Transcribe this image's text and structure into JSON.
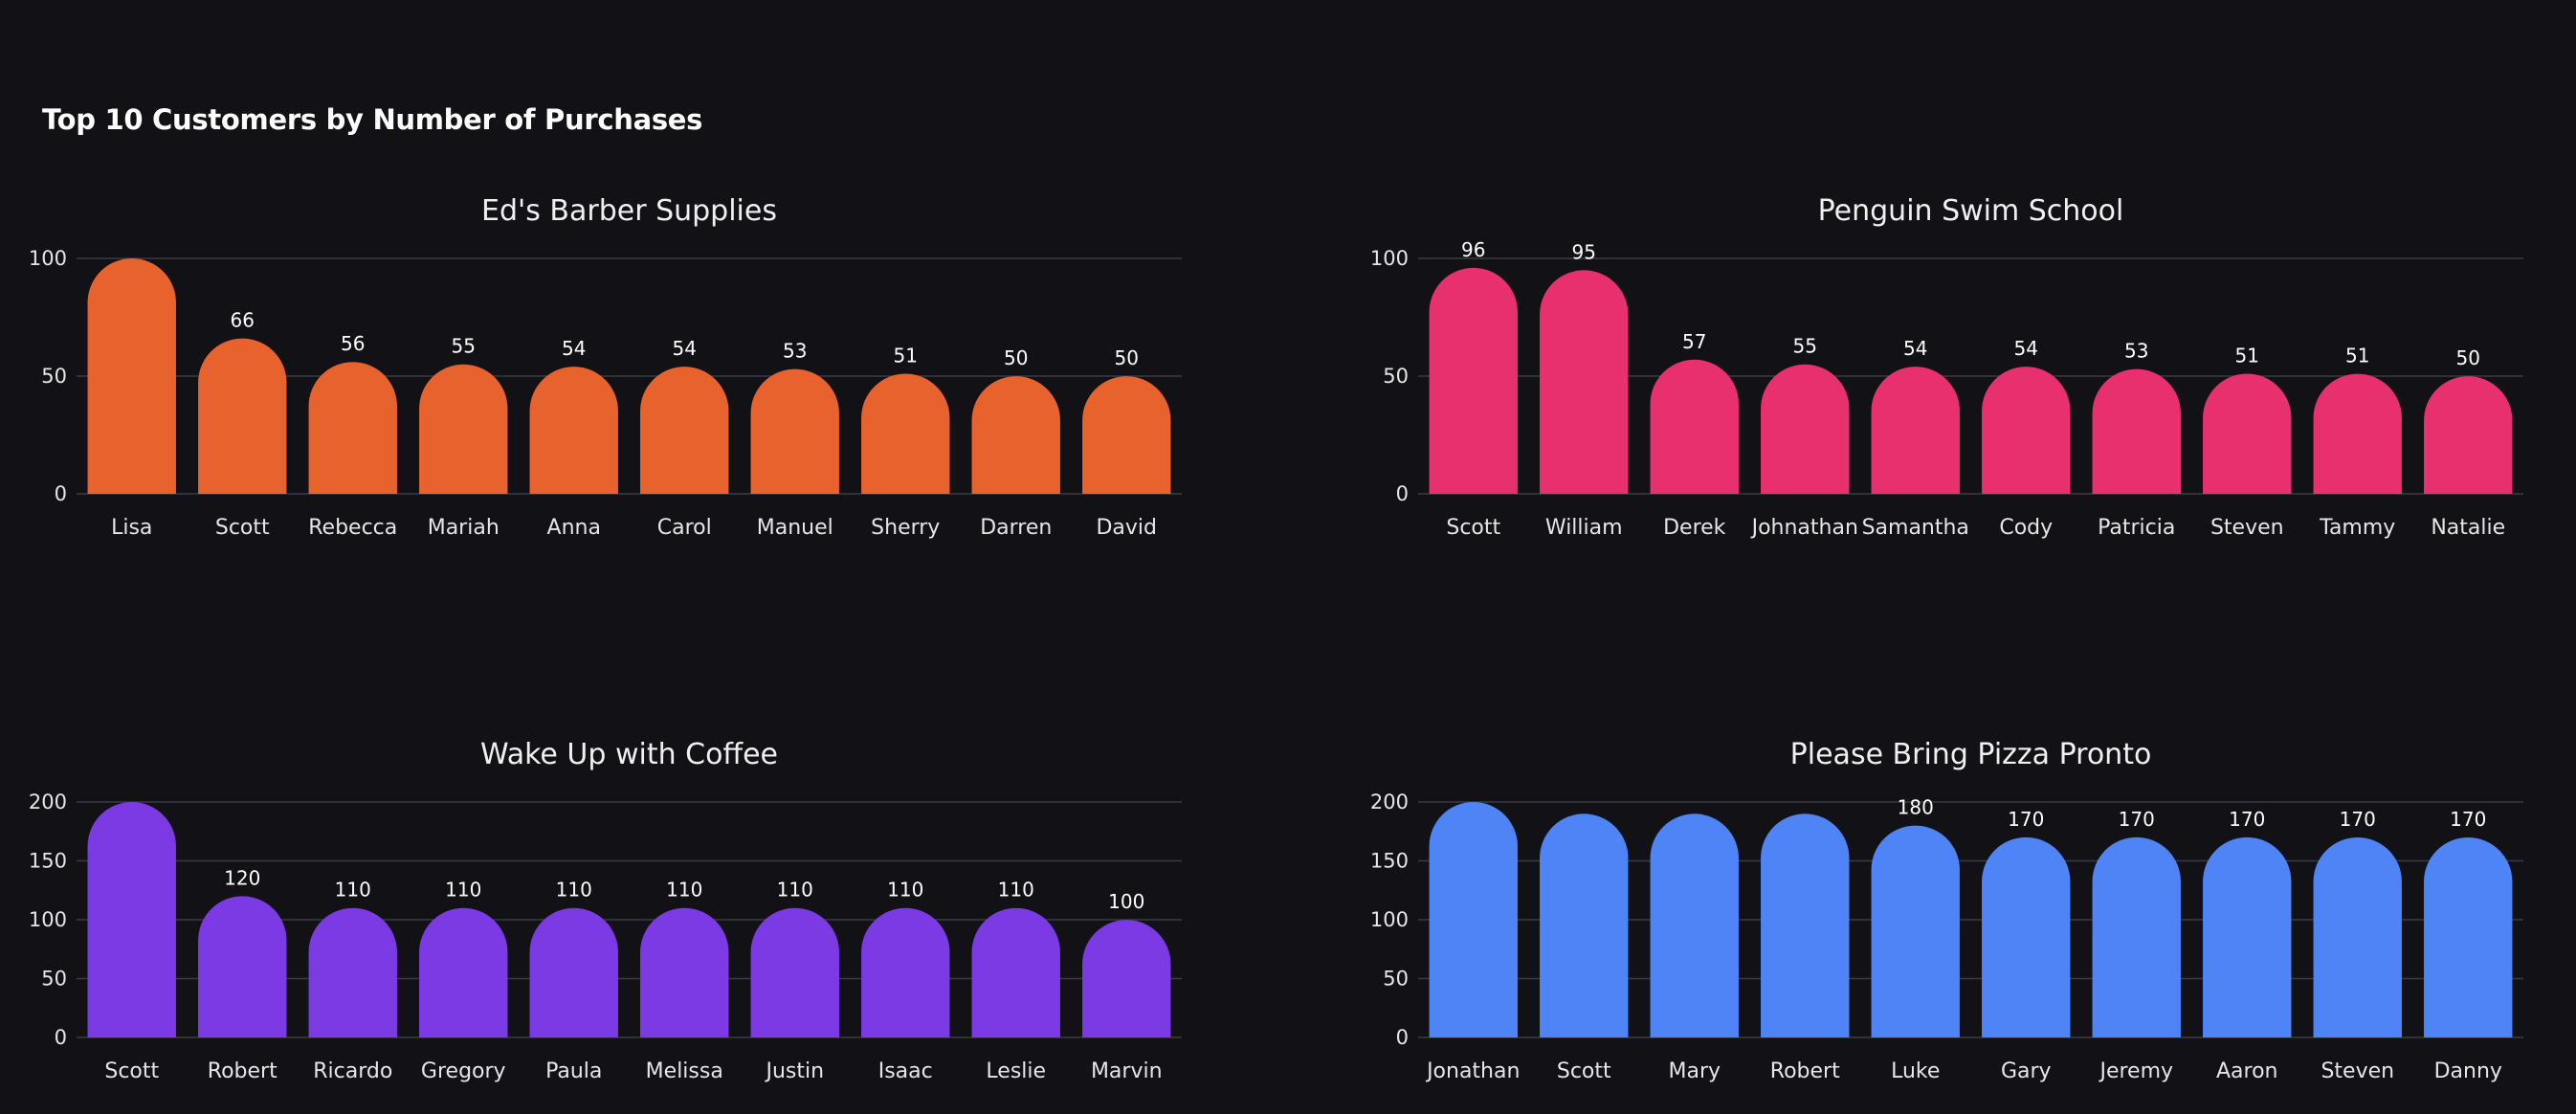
{
  "page": {
    "title": "Top 10 Customers by Number of Purchases"
  },
  "chart_data": [
    {
      "type": "bar",
      "title": "Ed's Barber Supplies",
      "color": "#e8622e",
      "categories": [
        "Lisa",
        "Scott",
        "Rebecca",
        "Mariah",
        "Anna",
        "Carol",
        "Manuel",
        "Sherry",
        "Darren",
        "David"
      ],
      "values": [
        100,
        66,
        56,
        55,
        54,
        54,
        53,
        51,
        50,
        50
      ],
      "data_labels": [
        "",
        "66",
        "56",
        "55",
        "54",
        "54",
        "53",
        "51",
        "50",
        "50"
      ],
      "yticks": [
        0,
        50,
        100
      ],
      "ylim": [
        0,
        100
      ],
      "grid": true,
      "xlabel": "",
      "ylabel": ""
    },
    {
      "type": "bar",
      "title": "Penguin Swim School",
      "color": "#e8306e",
      "categories": [
        "Scott",
        "William",
        "Derek",
        "Johnathan",
        "Samantha",
        "Cody",
        "Patricia",
        "Steven",
        "Tammy",
        "Natalie"
      ],
      "values": [
        96,
        95,
        57,
        55,
        54,
        54,
        53,
        51,
        51,
        50
      ],
      "data_labels": [
        "96",
        "95",
        "57",
        "55",
        "54",
        "54",
        "53",
        "51",
        "51",
        "50"
      ],
      "yticks": [
        0,
        50,
        100
      ],
      "ylim": [
        0,
        100
      ],
      "grid": true,
      "xlabel": "",
      "ylabel": ""
    },
    {
      "type": "bar",
      "title": "Wake Up with Coffee",
      "color": "#7b3ae4",
      "categories": [
        "Scott",
        "Robert",
        "Ricardo",
        "Gregory",
        "Paula",
        "Melissa",
        "Justin",
        "Isaac",
        "Leslie",
        "Marvin"
      ],
      "values": [
        200,
        120,
        110,
        110,
        110,
        110,
        110,
        110,
        110,
        100
      ],
      "data_labels": [
        "",
        "120",
        "110",
        "110",
        "110",
        "110",
        "110",
        "110",
        "110",
        "100"
      ],
      "yticks": [
        0,
        50,
        100,
        150,
        200
      ],
      "ylim": [
        0,
        200
      ],
      "grid": true,
      "xlabel": "",
      "ylabel": ""
    },
    {
      "type": "bar",
      "title": "Please Bring Pizza Pronto",
      "color": "#4f84f7",
      "categories": [
        "Jonathan",
        "Scott",
        "Mary",
        "Robert",
        "Luke",
        "Gary",
        "Jeremy",
        "Aaron",
        "Steven",
        "Danny"
      ],
      "values": [
        200,
        190,
        190,
        190,
        180,
        170,
        170,
        170,
        170,
        170
      ],
      "data_labels": [
        "",
        "",
        "",
        "",
        "180",
        "170",
        "170",
        "170",
        "170",
        "170"
      ],
      "yticks": [
        0,
        50,
        100,
        150,
        200
      ],
      "ylim": [
        0,
        200
      ],
      "grid": true,
      "xlabel": "",
      "ylabel": ""
    }
  ]
}
